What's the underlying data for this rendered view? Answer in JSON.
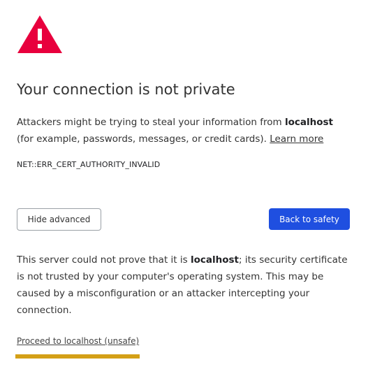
{
  "colors": {
    "warning": "#e8003d",
    "primary_button": "#1f4fe0",
    "focus_highlight": "#d4a017"
  },
  "icon": "warning-triangle-icon",
  "title": "Your connection is not private",
  "message": {
    "before_host": "Attackers might be trying to steal your information from ",
    "host": "localhost",
    "after_host": " (for example, passwords, messages, or credit cards). ",
    "learn_more": "Learn more"
  },
  "error_code": "NET::ERR_CERT_AUTHORITY_INVALID",
  "buttons": {
    "hide_advanced": "Hide advanced",
    "back_to_safety": "Back to safety"
  },
  "details": {
    "before_host": "This server could not prove that it is ",
    "host": "localhost",
    "after_host": "; its security certificate is not trusted by your computer's operating system. This may be caused by a misconfiguration or an attacker intercepting your connection."
  },
  "proceed_link": "Proceed to localhost (unsafe)"
}
